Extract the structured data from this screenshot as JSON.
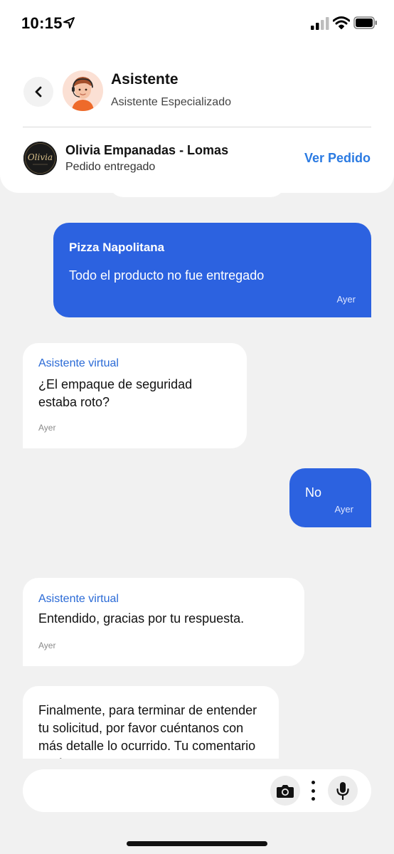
{
  "status_bar": {
    "time": "10:15",
    "icons": [
      "location-arrow-icon",
      "cellular-signal-icon",
      "wifi-icon",
      "battery-icon"
    ]
  },
  "header": {
    "title": "Asistente",
    "subtitle": "Asistente Especializado",
    "back_icon": "chevron-left-icon",
    "store": {
      "name": "Olivia Empanadas - Lomas",
      "status": "Pedido entregado",
      "logo_text": "Olivia",
      "action_label": "Ver Pedido"
    }
  },
  "messages": [
    {
      "direction": "out",
      "title": "Pizza Napolitana",
      "text": "Todo el producto no fue entregado",
      "time": "Ayer"
    },
    {
      "direction": "in",
      "sender": "Asistente virtual",
      "text": "¿El empaque de seguridad estaba roto?",
      "time": "Ayer"
    },
    {
      "direction": "out",
      "text": "No",
      "time": "Ayer"
    },
    {
      "direction": "in",
      "sender": "Asistente virtual",
      "text": "Entendido, gracias por tu respuesta.",
      "time": "Ayer"
    },
    {
      "direction": "in",
      "text": "Finalmente, para terminar de entender tu solicitud, por favor cuéntanos con más detalle lo ocurrido. Tu comentario será"
    }
  ],
  "input_bar": {
    "icons": [
      "camera-icon",
      "more-vertical-icon",
      "microphone-icon"
    ]
  },
  "colors": {
    "accent": "#2c62e0",
    "link": "#2a7ae2",
    "background": "#f1f1f1"
  }
}
